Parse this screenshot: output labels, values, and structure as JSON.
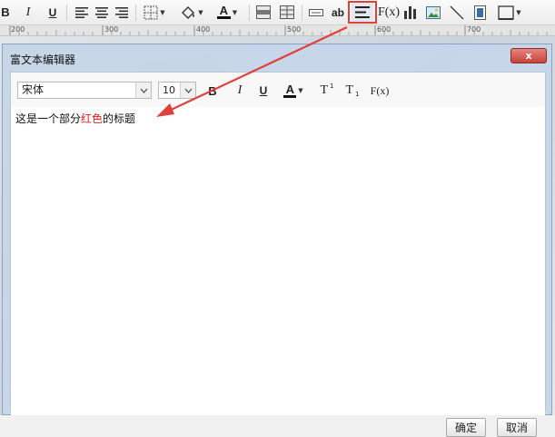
{
  "toolbar": {
    "bold": "B",
    "italic": "I",
    "underline": "U",
    "text_color": "A",
    "formula": "F(x)",
    "ab": "ab"
  },
  "ruler": {
    "labels": [
      "200",
      "300",
      "400",
      "500",
      "600",
      "700"
    ]
  },
  "dialog": {
    "title": "富文本编辑器",
    "close": "x",
    "font_value": "宋体",
    "size_value": "10",
    "toolbar": {
      "bold": "B",
      "italic": "I",
      "underline": "U",
      "text_color": "A",
      "superscript": "T",
      "superscript_mark": "1",
      "subscript": "T",
      "subscript_mark": "1",
      "formula": "F(x)"
    },
    "content": {
      "part1": "这是一个部分",
      "red_part": "红色",
      "part2": "的标题"
    },
    "ok_button": "确定",
    "cancel_button": "取消"
  },
  "colors": {
    "highlight": "#e0403a",
    "red_text": "#e02020",
    "dialog_border": "#8aa3bf"
  }
}
